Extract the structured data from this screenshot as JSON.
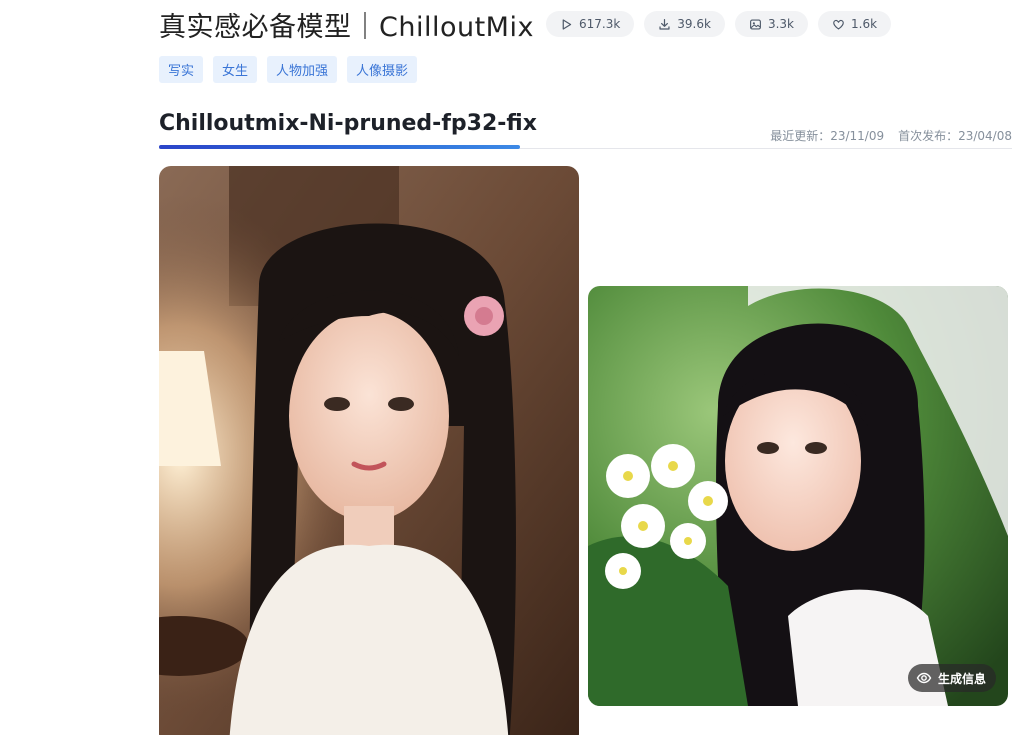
{
  "model": {
    "title": "真实感必备模型｜ChilloutMix",
    "stats": [
      {
        "icon": "play-icon",
        "value": "617.3k"
      },
      {
        "icon": "download-icon",
        "value": "39.6k"
      },
      {
        "icon": "image-icon",
        "value": "3.3k"
      },
      {
        "icon": "heart-icon",
        "value": "1.6k"
      }
    ],
    "tags": [
      "写实",
      "女生",
      "人物加强",
      "人像摄影"
    ]
  },
  "version": {
    "name": "Chilloutmix-Ni-pruned-fp32-fix",
    "updated": "最近更新：23/11/09",
    "published": "首次发布：23/04/08"
  },
  "gallery": {
    "generate_info_label": "生成信息"
  },
  "colors": {
    "accent": "#2b45c9",
    "tag_bg": "#e8f1fd",
    "tag_text": "#3a75d6"
  }
}
